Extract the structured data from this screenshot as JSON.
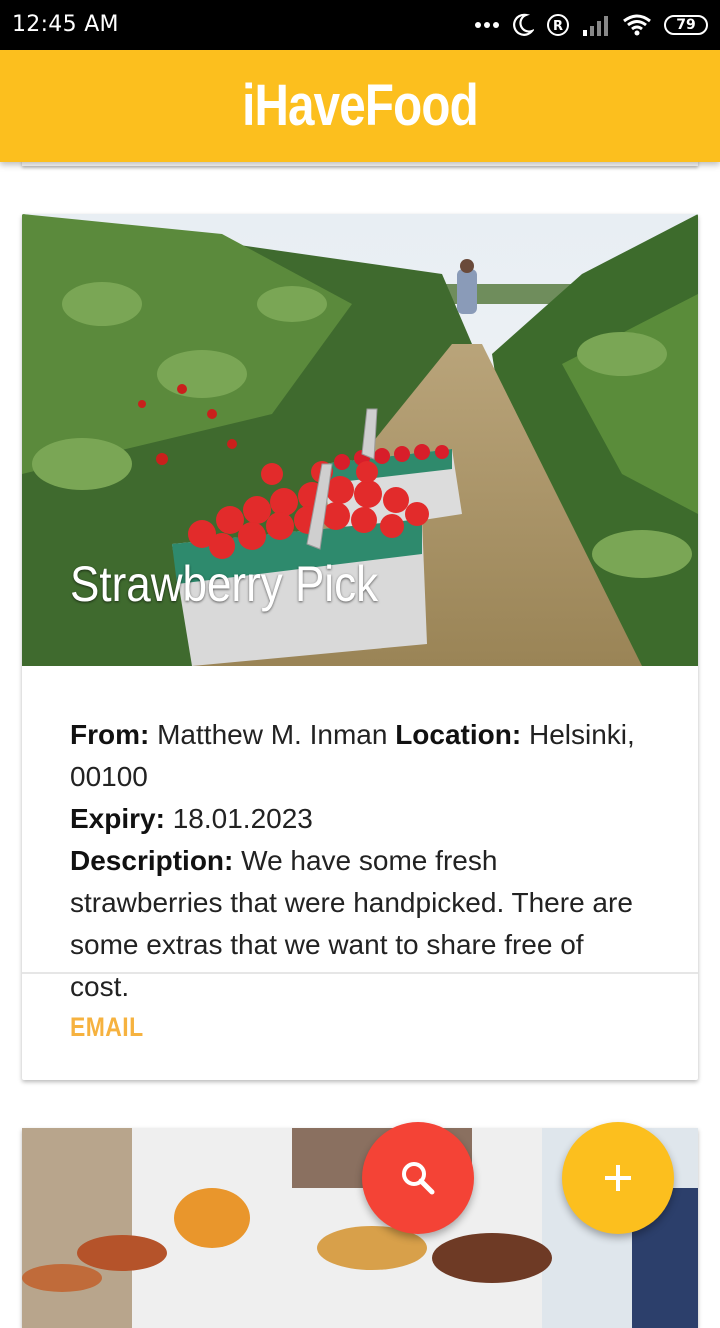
{
  "status_bar": {
    "time": "12:45 AM",
    "battery": "79"
  },
  "app_bar": {
    "title": "iHaveFood"
  },
  "cards": [
    {
      "title": "Strawberry Pick",
      "from_label": "From:",
      "from_value": "Matthew M. Inman",
      "location_label": "Location:",
      "location_value": "Helsinki, 00100",
      "expiry_label": "Expiry:",
      "expiry_value": "18.01.2023",
      "description_label": "Description:",
      "description_value": "We have some fresh strawberries that were handpicked. There are some extras that we want to share free of cost.",
      "action_label": "EMAIL"
    }
  ],
  "fabs": {
    "search_icon": "search-icon",
    "add_icon": "add-icon"
  },
  "colors": {
    "app_bar": "#fcbf1e",
    "accent_text": "#f6b23f",
    "fab_search": "#f44336",
    "fab_add": "#fcbf1e"
  }
}
